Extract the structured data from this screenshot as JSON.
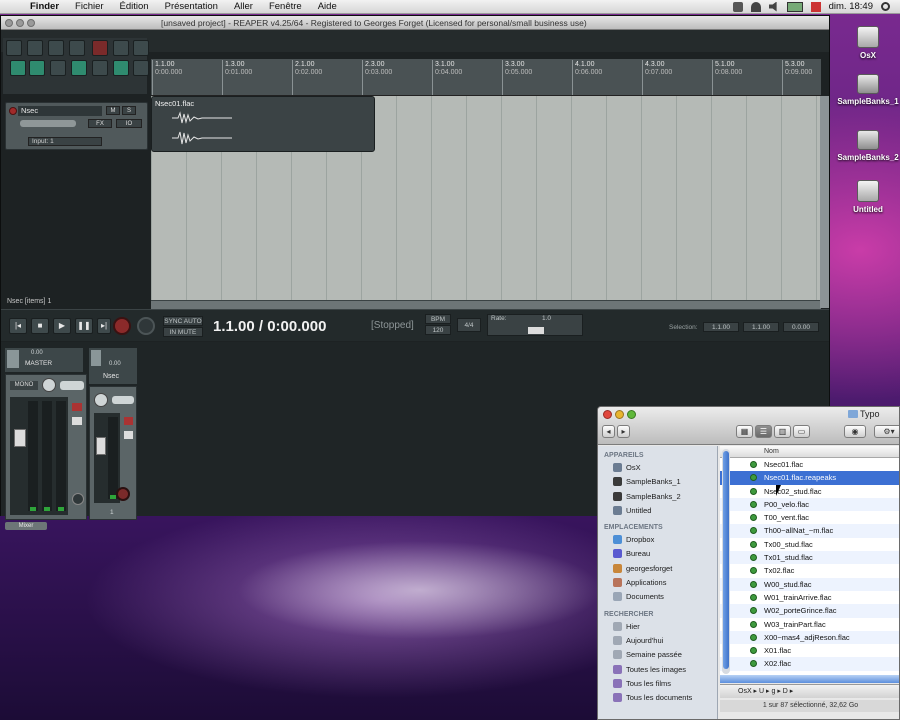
{
  "menubar": {
    "items": [
      "Finder",
      "Fichier",
      "Édition",
      "Présentation",
      "Aller",
      "Fenêtre",
      "Aide"
    ],
    "clock": "dim. 18:49"
  },
  "reaper": {
    "title": "[unsaved project] - REAPER v4.25/64 - Registered to Georges Forget (Licensed for personal/small business use)",
    "ruler_ticks": [
      {
        "bar": "1.1.00",
        "time": "0:00.000"
      },
      {
        "bar": "1.3.00",
        "time": "0:01.000"
      },
      {
        "bar": "2.1.00",
        "time": "0:02.000"
      },
      {
        "bar": "2.3.00",
        "time": "0:03.000"
      },
      {
        "bar": "3.1.00",
        "time": "0:04.000"
      },
      {
        "bar": "3.3.00",
        "time": "0:05.000"
      },
      {
        "bar": "4.1.00",
        "time": "0:06.000"
      },
      {
        "bar": "4.3.00",
        "time": "0:07.000"
      },
      {
        "bar": "5.1.00",
        "time": "0:08.000"
      },
      {
        "bar": "5.3.00",
        "time": "0:09.000"
      }
    ],
    "item_name": "Nsec01.flac",
    "track": {
      "name": "Nsec",
      "vol": "0.00",
      "input": "Input: 1",
      "status_text": "Nsec [items] 1"
    },
    "transport": {
      "timecode": "1.1.00 / 0:00.000",
      "status": "[Stopped]",
      "bpm_label": "BPM",
      "bpm": "120",
      "ts": "4/4",
      "rate_label": "Rate:",
      "rate": "1.0",
      "selection_label": "Selection:",
      "sel_start": "1.1.00",
      "sel_end": "1.1.00",
      "sel_len": "0.0.00",
      "sync_label": "SYNC AUTO",
      "sync_value": "IN MUTE"
    },
    "mixer": {
      "master_label": "MASTER",
      "master_vol": "0.00",
      "mono_label": "MONO",
      "track_name": "Nsec",
      "track_vol": "0.00",
      "track_number": "1",
      "tab_label": "Mixer"
    }
  },
  "desktop": {
    "icons": [
      "OsX",
      "SampleBanks_1",
      "SampleBanks_2",
      "Untitled"
    ]
  },
  "finder": {
    "title": "Typo",
    "sidebar": {
      "devices_label": "APPAREILS",
      "devices": [
        "OsX",
        "SampleBanks_1",
        "SampleBanks_2",
        "Untitled"
      ],
      "places_label": "EMPLACEMENTS",
      "places": [
        "Dropbox",
        "Bureau",
        "georgesforget",
        "Applications",
        "Documents"
      ],
      "search_label": "RECHERCHER",
      "searches": [
        "Hier",
        "Aujourd'hui",
        "Semaine passée",
        "Toutes les images",
        "Tous les films",
        "Tous les documents"
      ]
    },
    "column_header": "Nom",
    "files": [
      "Nsec01.flac",
      "Nsec01.flac.reapeaks",
      "Nsec02_stud.flac",
      "P00_velo.flac",
      "T00_vent.flac",
      "Th00~allNat_~m.flac",
      "Tx00_stud.flac",
      "Tx01_stud.flac",
      "Tx02.flac",
      "W00_stud.flac",
      "W01_trainArrive.flac",
      "W02_porteGrince.flac",
      "W03_trainPart.flac",
      "X00~mas4_adjReson.flac",
      "X01.flac",
      "X02.flac"
    ],
    "selected_index": 1,
    "path": "OsX ▸ U ▸ g ▸ D ▸",
    "status": "1 sur 87 sélectionné, 32,62 Go"
  },
  "colors": {
    "accent": "#3c70d3",
    "arrange_bg": "#b5bab6",
    "reaper_bg": "#1d2223",
    "meter_green": "#2ea43a"
  }
}
